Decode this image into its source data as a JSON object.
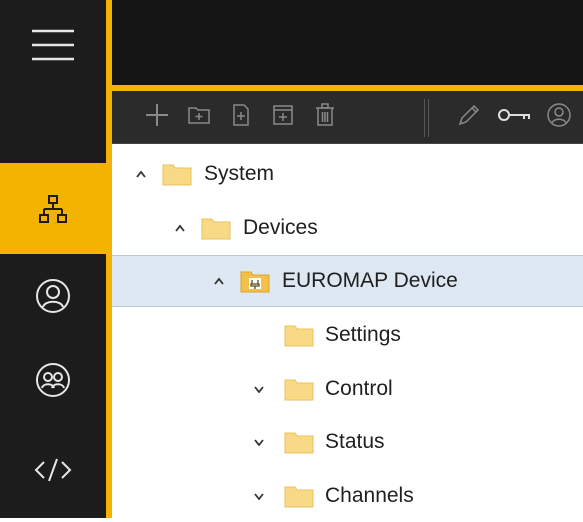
{
  "colors": {
    "accent": "#f5b301",
    "rail_bg": "#1c1c1c",
    "header_bg": "#151515",
    "toolbar_bg": "#2b2b2b",
    "selected_row": "#dde8f2",
    "folder": "#f7d986"
  },
  "rail": {
    "items": [
      {
        "icon": "menu-icon"
      },
      {
        "icon": "network-hierarchy-icon",
        "active": true
      },
      {
        "icon": "user-icon"
      },
      {
        "icon": "user-group-icon"
      },
      {
        "icon": "code-icon"
      }
    ]
  },
  "toolbar": {
    "icons": [
      "add-icon",
      "add-folder-icon",
      "add-file-icon",
      "add-object-icon",
      "delete-icon",
      "edit-icon",
      "key-icon",
      "user-icon"
    ]
  },
  "tree": {
    "rows": [
      {
        "label": "System",
        "expanded": true
      },
      {
        "label": "Devices",
        "expanded": true
      },
      {
        "label": "EUROMAP Device",
        "expanded": true,
        "selected": true,
        "device": true
      },
      {
        "label": "Settings"
      },
      {
        "label": "Control",
        "expanded": false
      },
      {
        "label": "Status",
        "expanded": false
      },
      {
        "label": "Channels",
        "expanded": false
      }
    ]
  }
}
